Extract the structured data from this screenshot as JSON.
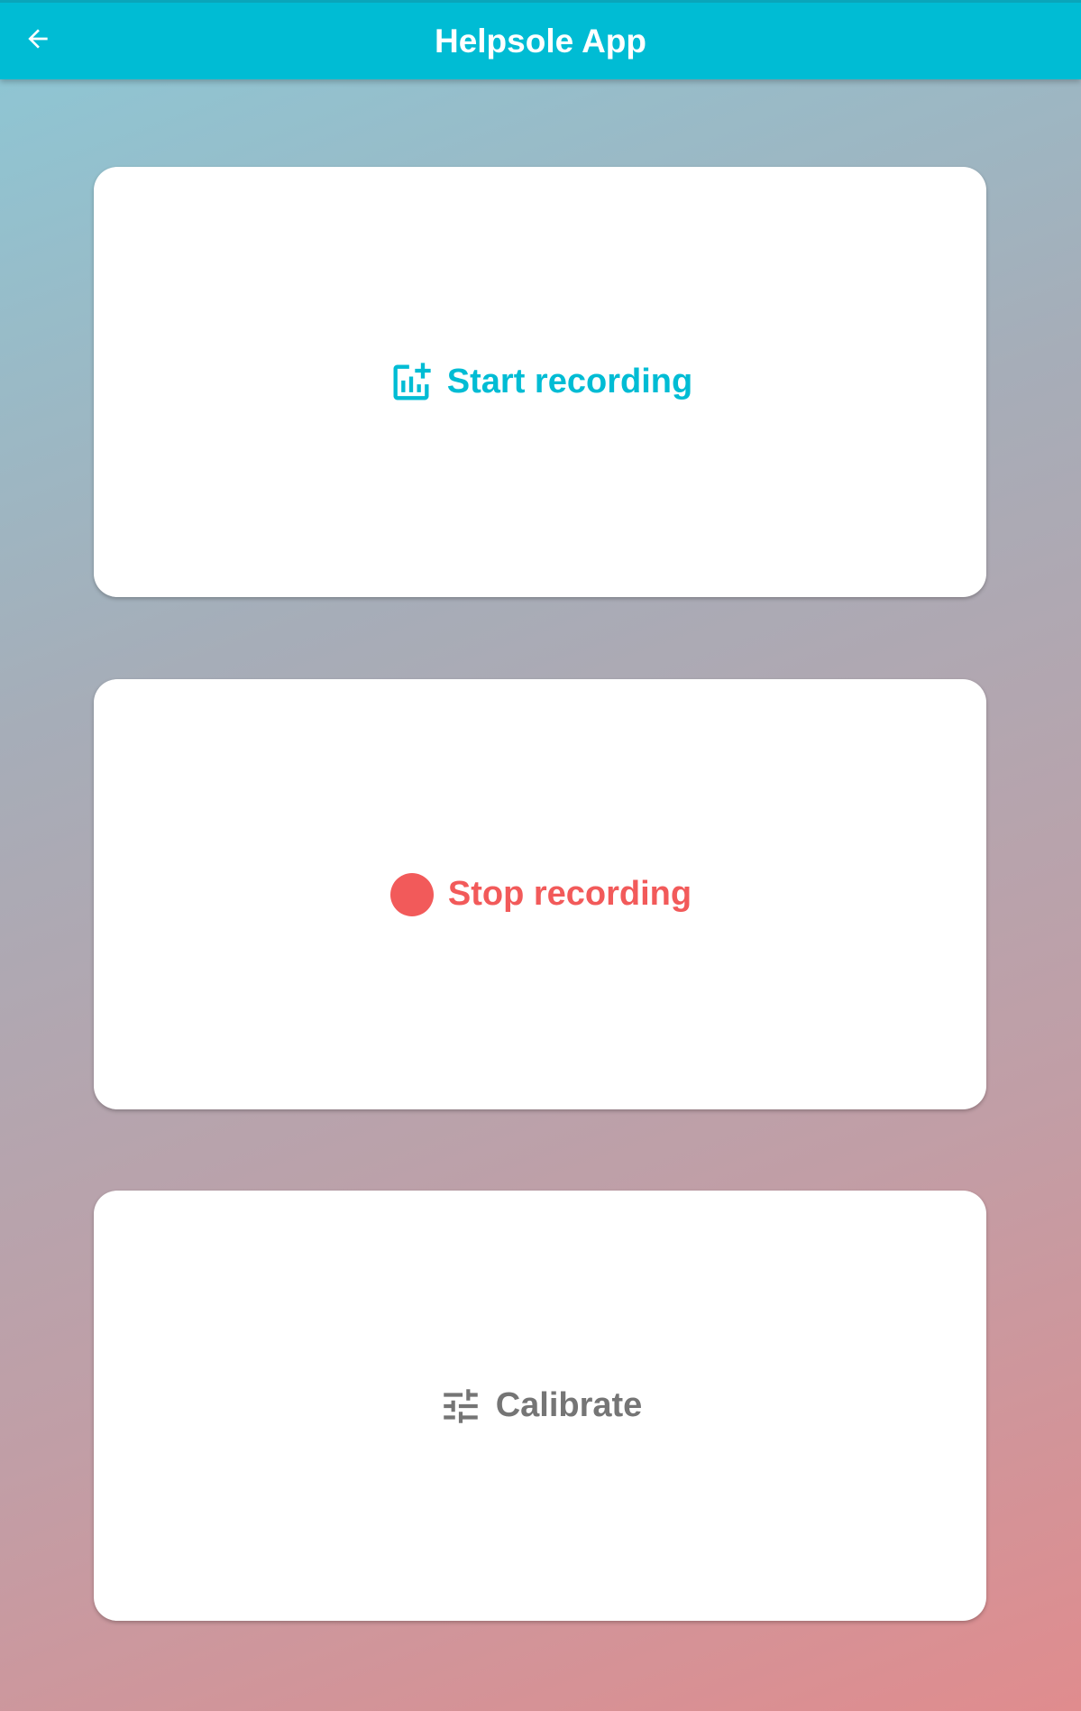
{
  "app_bar": {
    "title": "Helpsole App",
    "back_icon": "arrow-back-icon",
    "color": "#00bcd4"
  },
  "actions": [
    {
      "label": "Start recording",
      "icon": "add-chart-icon",
      "color": "#00bcd4"
    },
    {
      "label": "Stop recording",
      "icon": "record-dot-icon",
      "color": "#f25a5a"
    },
    {
      "label": "Calibrate",
      "icon": "tune-icon",
      "color": "#757575"
    }
  ]
}
